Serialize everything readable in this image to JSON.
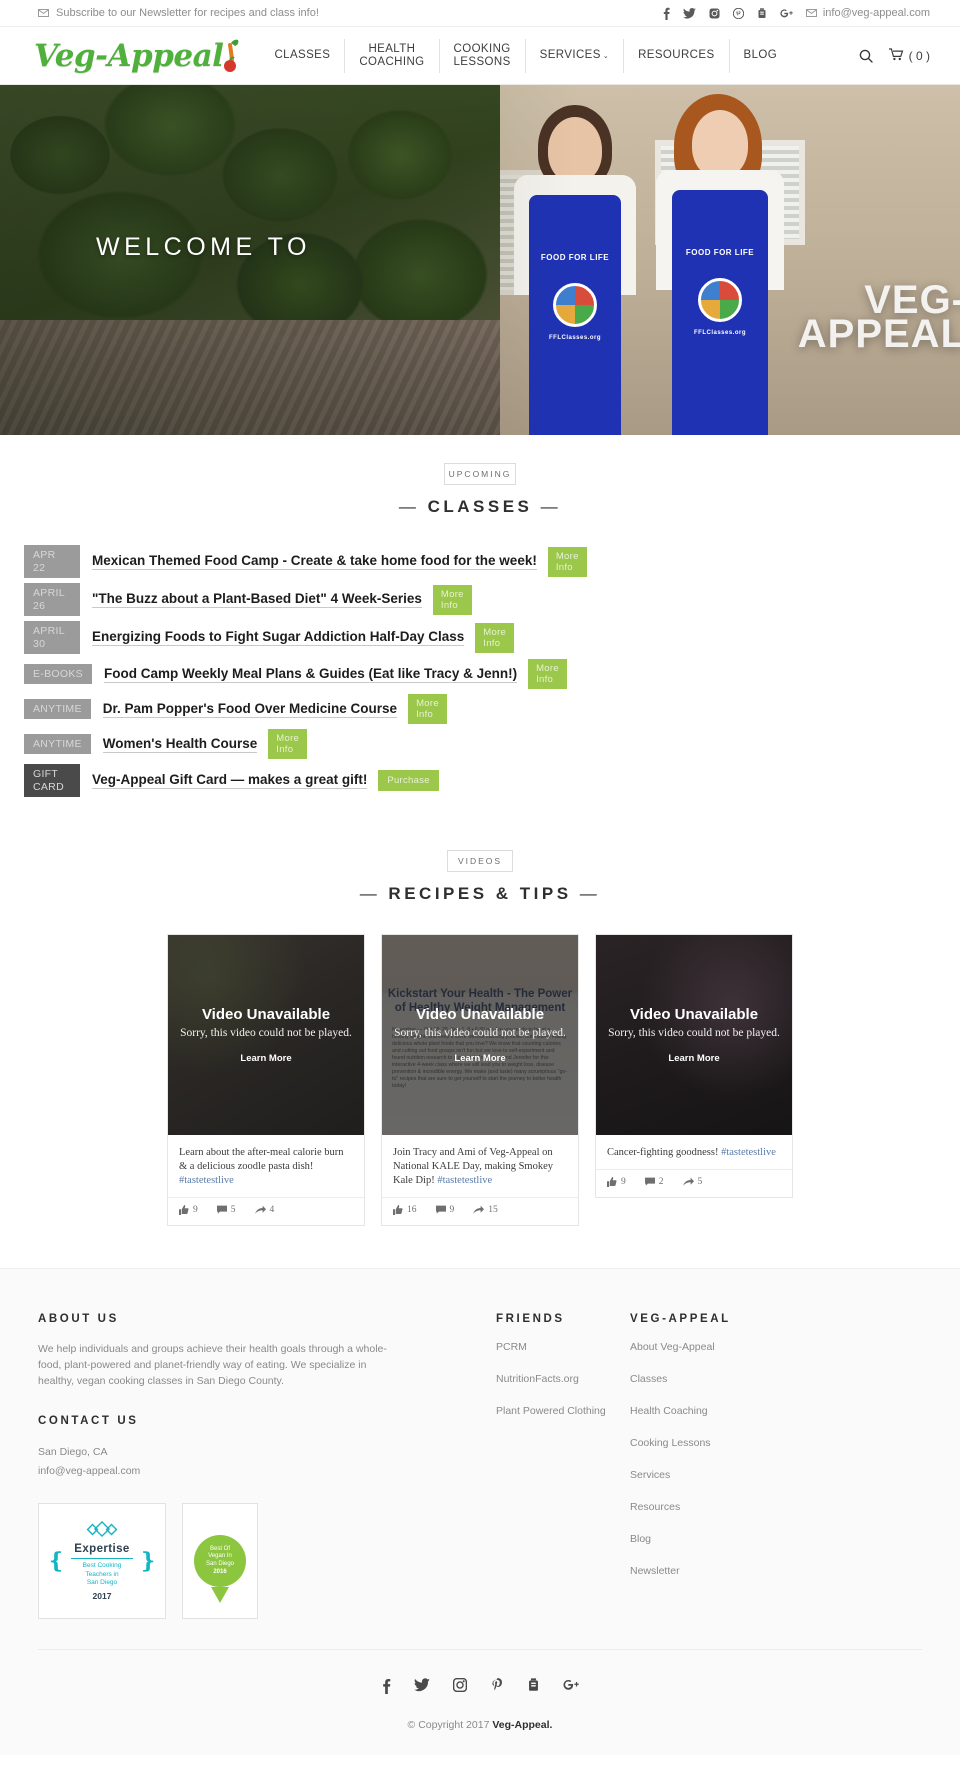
{
  "topbar": {
    "newsletter_text": "Subscribe to our Newsletter for recipes and class info!",
    "email": "info@veg-appeal.com",
    "social": [
      "facebook-icon",
      "twitter-icon",
      "instagram-icon",
      "pinterest-icon",
      "youtube-icon",
      "googleplus-icon"
    ]
  },
  "header": {
    "logo": "Veg-Appeal",
    "nav": [
      {
        "label": "CLASSES"
      },
      {
        "label": "HEALTH\nCOACHING"
      },
      {
        "label": "COOKING\nLESSONS"
      },
      {
        "label": "SERVICES",
        "caret": "⌄"
      },
      {
        "label": "RESOURCES"
      },
      {
        "label": "BLOG"
      }
    ],
    "cart_label": "( 0 )"
  },
  "hero": {
    "welcome": "WELCOME TO",
    "brand_line1": "VEG-",
    "brand_line2": "APPEAL",
    "apron_text_top": "FOOD FOR LIFE",
    "apron_text_bottom": "FFLClasses.org"
  },
  "classes_section": {
    "eyebrow": "UPCOMING",
    "title": "CLASSES",
    "rows": [
      {
        "date": "APR\n22",
        "title": "Mexican Themed Food Camp - Create & take home food for the week!",
        "button": "More\nInfo",
        "dark": false
      },
      {
        "date": "APRIL\n26",
        "title": "\"The Buzz about a Plant-Based Diet\" 4 Week-Series",
        "button": "More\nInfo",
        "dark": false
      },
      {
        "date": "APRIL\n30",
        "title": "Energizing Foods to Fight Sugar Addiction Half-Day Class",
        "button": "More\nInfo",
        "dark": false
      },
      {
        "date": "E-BOOKS",
        "title": "Food Camp Weekly Meal Plans & Guides (Eat like Tracy & Jenn!)",
        "button": "More\nInfo",
        "dark": false
      },
      {
        "date": "ANYTIME",
        "title": "Dr. Pam Popper's Food Over Medicine Course",
        "button": "More\nInfo",
        "dark": false
      },
      {
        "date": "ANYTIME",
        "title": "Women's Health Course",
        "button": "More\nInfo",
        "dark": false
      },
      {
        "date": "GIFT\nCARD",
        "title": "Veg-Appeal Gift Card — makes a great gift!",
        "button": "Purchase",
        "dark": true
      }
    ]
  },
  "videos_section": {
    "eyebrow": "VIDEOS",
    "title": "RECIPES & TIPS",
    "unavailable_title": "Video Unavailable",
    "unavailable_sub": "Sorry, this video could not be played.",
    "learn_more": "Learn More",
    "cards": [
      {
        "caption": "Learn about the after-meal calorie burn & a delicious zoodle pasta dish! ",
        "hashtag": "#tastetestlive",
        "likes": "9",
        "comments": "5",
        "shares": "4",
        "thumb_text": ""
      },
      {
        "caption": "Join Tracy and Ami of Veg-Appeal on National KALE Day, making Smokey Kale Dip! ",
        "hashtag": "#tastetestlive",
        "likes": "16",
        "comments": "9",
        "shares": "15",
        "thumb_text": "Kickstart Your Health - The Power of Healthy Weight Management",
        "thumb_body": "November — Oct 18, 25, Nov 1, 8 • 6:30 pm   Are you ready to be at a healthy weight, and keep it there without starving yourself but instead eating delicious whole plant foods that you love? We know that counting calories and cutting out food groups isn't fun but we love to self-experiment and found nutrition research to support it. Join Tracy and Jennifer for this interactive 4-week class where we will lead you to weight loss, disease prevention & incredible energy. We make (and taste) many scrumptious \"go-to\" recipes that are sure to get yourself to start the journey to better health today!"
      },
      {
        "caption": "Cancer-fighting goodness! ",
        "hashtag": "#tastetestlive",
        "likes": "9",
        "comments": "2",
        "shares": "5",
        "thumb_text": ""
      }
    ]
  },
  "footer": {
    "about_heading": "ABOUT US",
    "about_text": "We help individuals and groups achieve their health goals through a whole-food, plant-powered and planet-friendly way of eating. We specialize in healthy, vegan cooking classes in San Diego County.",
    "contact_heading": "CONTACT US",
    "contact_city": "San Diego, CA",
    "contact_email": "info@veg-appeal.com",
    "badge_expertise": {
      "name": "Expertise",
      "line1": "Best Cooking",
      "line2": "Teachers in",
      "line3": "San Diego",
      "year": "2017"
    },
    "badge_best": {
      "line1": "Best Of",
      "line2": "Vegan In",
      "line3": "San Diego",
      "year": "2016"
    },
    "friends_heading": "FRIENDS",
    "friends_links": [
      "PCRM",
      "NutritionFacts.org",
      "Plant Powered Clothing"
    ],
    "brand_heading": "VEG-APPEAL",
    "brand_links": [
      "About Veg-Appeal",
      "Classes",
      "Health Coaching",
      "Cooking Lessons",
      "Services",
      "Resources",
      "Blog",
      "Newsletter"
    ],
    "social": [
      "facebook-icon",
      "twitter-icon",
      "instagram-icon",
      "pinterest-icon",
      "youtube-icon",
      "googleplus-icon"
    ],
    "copyright_prefix": "© Copyright 2017 ",
    "copyright_brand": "Veg-Appeal."
  }
}
